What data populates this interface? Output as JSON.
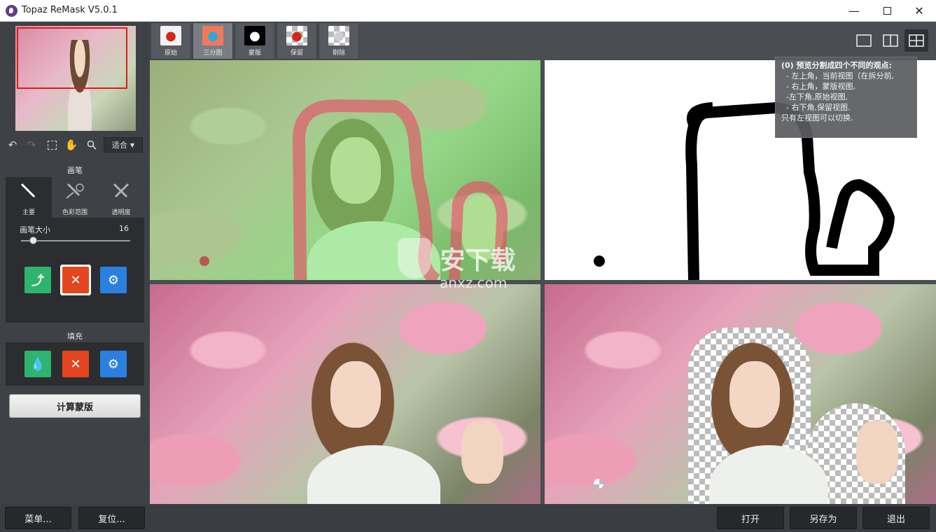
{
  "window": {
    "title": "Topaz ReMask V5.0.1",
    "minimize_icon": "minimize-icon",
    "maximize_icon": "maximize-icon",
    "close_icon": "close-icon"
  },
  "toolbar": {
    "zoom_value": "适合"
  },
  "brush": {
    "section_label": "画笔",
    "tabs": [
      {
        "label": "主要",
        "icon": "brush-icon",
        "active": true
      },
      {
        "label": "色彩范围",
        "icon": "color-range-brush-icon",
        "active": false
      },
      {
        "label": "透明度",
        "icon": "transparency-brush-icon",
        "active": false
      }
    ],
    "size_label": "画笔大小",
    "size_value": "16",
    "size_fraction": 0.12,
    "modes": [
      {
        "name": "keep",
        "color": "#2fb36e"
      },
      {
        "name": "cut",
        "color": "#e3461e",
        "active": true
      },
      {
        "name": "compute",
        "color": "#2b7fe0"
      }
    ]
  },
  "fill": {
    "section_label": "填充",
    "modes": [
      {
        "name": "keep",
        "color": "#2fb36e"
      },
      {
        "name": "cut",
        "color": "#e3461e"
      },
      {
        "name": "compute",
        "color": "#2b7fe0"
      }
    ]
  },
  "compute_button": "计算蒙版",
  "view_tabs": [
    {
      "label": "原始",
      "icon": "apple-icon",
      "active": false
    },
    {
      "label": "三分图",
      "icon": "tri-map-icon",
      "active": true
    },
    {
      "label": "蒙版",
      "icon": "mask-apple-icon",
      "active": false
    },
    {
      "label": "保留",
      "icon": "keep-apple-icon",
      "active": false
    },
    {
      "label": "剔除",
      "icon": "cut-apple-icon",
      "active": false
    }
  ],
  "layout_buttons": [
    "single-view-icon",
    "split-view-icon",
    "quad-view-icon"
  ],
  "tooltip": {
    "lines": [
      "(0) 预览分割成四个不同的观点:",
      "  - 左上角，当前视图（在拆分前,",
      "  - 右上角，蒙版视图,",
      "  -左下角,原始视图,",
      "  - 右下角,保留视图.",
      "只有左视图可以切换."
    ]
  },
  "watermark": {
    "text": "安下载",
    "sub": "anxz.com"
  },
  "bottom": {
    "menu": "菜单...",
    "reset": "复位...",
    "open": "打开",
    "save_as": "另存为",
    "exit": "退出"
  }
}
